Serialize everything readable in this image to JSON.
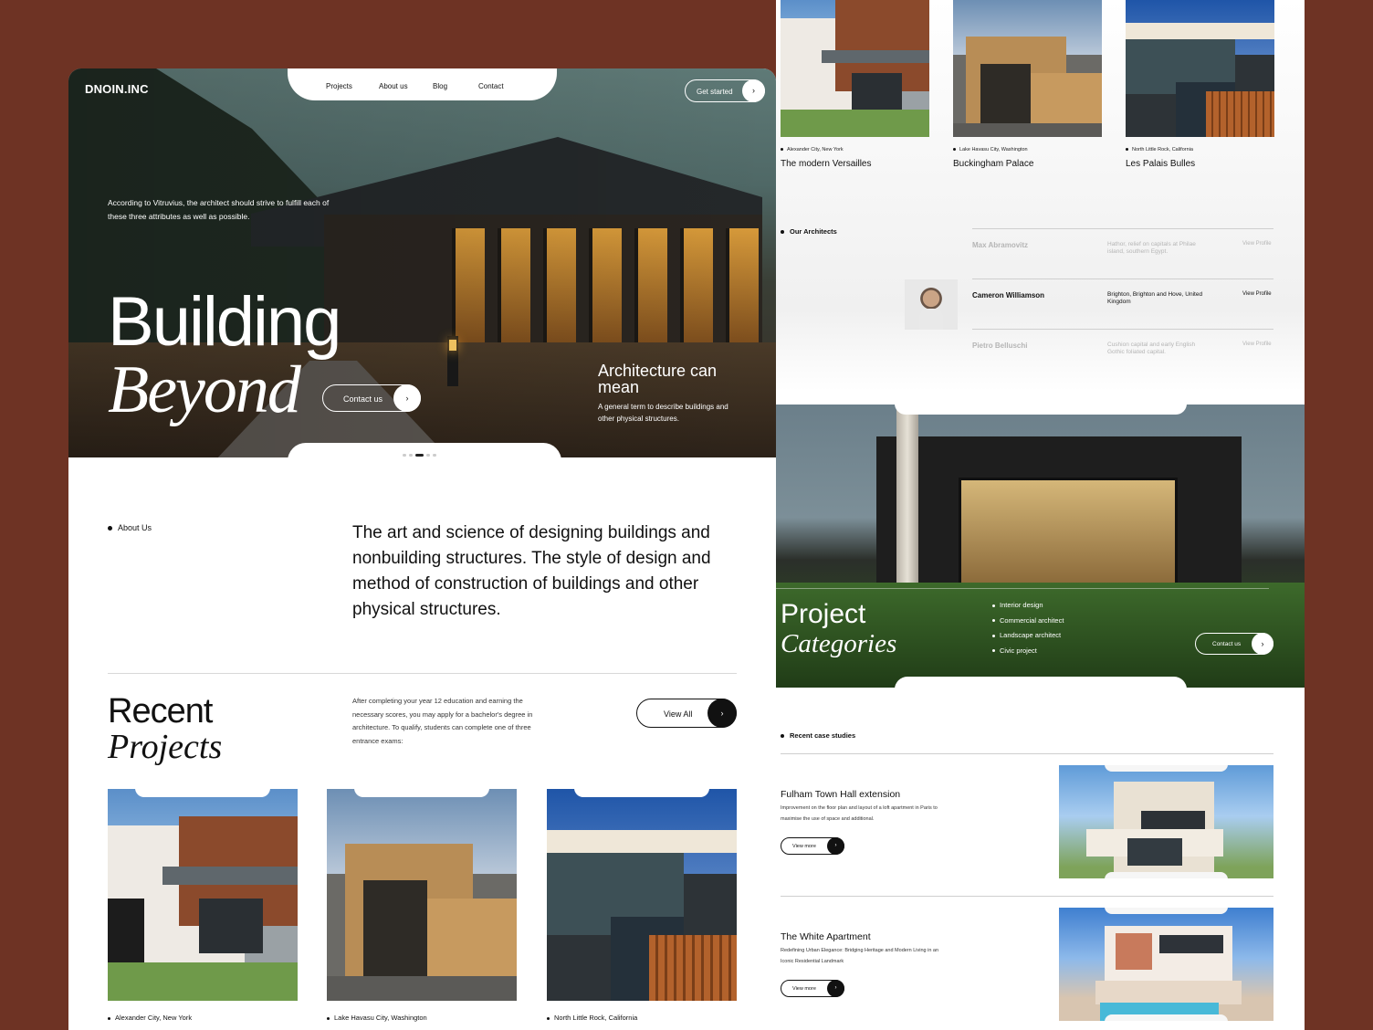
{
  "brand": "DNOIN.INC",
  "nav": [
    "Projects",
    "About us",
    "Blog",
    "Contact"
  ],
  "get_started": "Get started",
  "hero": {
    "quote": "According to Vitruvius, the architect should strive to fulfill each of these three attributes as well as possible.",
    "title_line1": "Building",
    "title_line2": "Beyond",
    "contact_label": "Contact us",
    "arch_title": "Architecture can mean",
    "arch_desc": "A general term to describe buildings and other physical structures.",
    "slide_count": 5,
    "active_slide": 3
  },
  "about": {
    "label": "About Us",
    "text": "The art and science of designing buildings and nonbuilding structures. The style of design and method of construction of buildings and other physical structures."
  },
  "recent": {
    "title_line1": "Recent",
    "title_line2": "Projects",
    "desc": "After completing your year 12 education and earning the necessary scores, you may apply for a bachelor's degree in architecture. To qualify, students can complete one of three entrance exams:",
    "view_all": "View All",
    "locations": [
      "Alexander City, New York",
      "Lake Havasu City, Washington",
      "North Little Rock, California"
    ]
  },
  "projects_top": [
    {
      "location": "Alexander City, New York",
      "name": "The modern Versailles"
    },
    {
      "location": "Lake Havasu City, Washington",
      "name": "Buckingham Palace"
    },
    {
      "location": "North Little Rock, California",
      "name": "Les Palais Bulles"
    }
  ],
  "architects": {
    "label": "Our Architects",
    "rows": [
      {
        "name": "Max Abramovitz",
        "location": "Hathor, relief on capitals at Philae island, southern Egypt.",
        "link": "View Profile"
      },
      {
        "name": "Cameron Williamson",
        "location": "Brighton, Brighton and Hove, United Kingdom",
        "link": "View Profile"
      },
      {
        "name": "Pietro Belluschi",
        "location": "Cushion capital and early English Gothic foliated capital.",
        "link": "View Profile"
      }
    ]
  },
  "categories": {
    "title_line1": "Project",
    "title_line2": "Categories",
    "items": [
      "Interior design",
      "Commercial architect",
      "Landscape architect",
      "Civic project"
    ],
    "contact_label": "Contact us"
  },
  "case_studies": {
    "label": "Recent case studies",
    "items": [
      {
        "title": "Fulham Town Hall extension",
        "desc": "Improvement on the floor plan and layout of a loft apartment in Paris to maximise the use of space and additional.",
        "button": "View more"
      },
      {
        "title": "The White Apartment",
        "desc": "Redefining Urban Elegance: Bridging Heritage and Modern Living in an Iconic Residential Landmark",
        "button": "View more"
      }
    ]
  },
  "colors": {
    "background": "#6e3324",
    "ink": "#111111"
  }
}
